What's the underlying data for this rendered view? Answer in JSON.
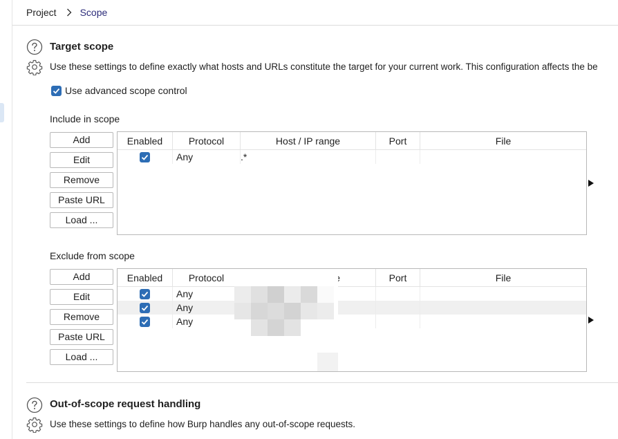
{
  "breadcrumb": {
    "project": "Project",
    "current": "Scope"
  },
  "target_scope": {
    "title": "Target scope",
    "description": "Use these settings to define exactly what hosts and URLs constitute the target for your current work. This configuration affects the be",
    "advanced_label": "Use advanced scope control",
    "advanced_checked": true
  },
  "include": {
    "label": "Include in scope",
    "buttons": [
      "Add",
      "Edit",
      "Remove",
      "Paste URL",
      "Load ..."
    ],
    "columns": [
      "Enabled",
      "Protocol",
      "Host / IP range",
      "Port",
      "File"
    ],
    "rows": [
      {
        "enabled": true,
        "protocol": "Any",
        "host": ".*",
        "port": "",
        "file": ""
      }
    ]
  },
  "exclude": {
    "label": "Exclude from scope",
    "buttons": [
      "Add",
      "Edit",
      "Remove",
      "Paste URL",
      "Load ..."
    ],
    "columns": [
      "Enabled",
      "Protocol",
      "Host / IP range",
      "Port",
      "File"
    ],
    "rows": [
      {
        "enabled": true,
        "protocol": "Any",
        "host": "",
        "port": "",
        "file": ""
      },
      {
        "enabled": true,
        "protocol": "Any",
        "host": "",
        "port": "",
        "file": ""
      },
      {
        "enabled": true,
        "protocol": "Any",
        "host": "",
        "port": "",
        "file": ""
      }
    ]
  },
  "out_of_scope": {
    "title": "Out-of-scope request handling",
    "description": "Use these settings to define how Burp handles any out-of-scope requests."
  },
  "colors": {
    "accent": "#2d6db5",
    "breadcrumb_current": "#2c2c7a"
  }
}
